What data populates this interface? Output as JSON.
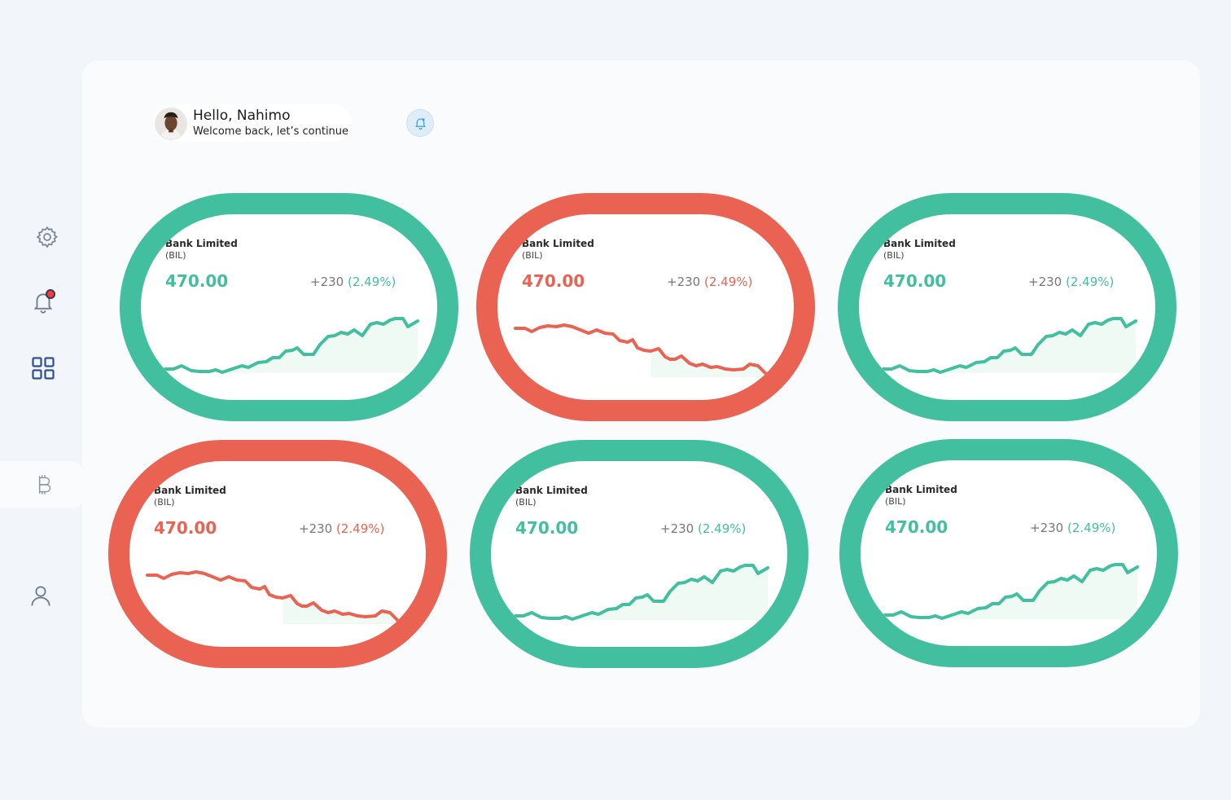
{
  "header": {
    "greeting": "Hello, Nahimo",
    "subtitle": "Welcome back, let’s continue"
  },
  "sidebar": {
    "items": [
      {
        "icon": "gear-icon"
      },
      {
        "icon": "bell-icon",
        "has_badge": true
      },
      {
        "icon": "grid-icon"
      },
      {
        "icon": "bitcoin-icon",
        "active": true
      },
      {
        "icon": "user-icon"
      }
    ]
  },
  "colors": {
    "up": "#41bf9f",
    "down": "#ea6251",
    "page_bg": "#f2f5f9",
    "panel_bg": "#f9fbfd"
  },
  "cards": [
    {
      "name": "Bank Limited",
      "ticker": "(BIL)",
      "price": "470.00",
      "change": "+230",
      "percent": "(2.49%)",
      "trend": "up"
    },
    {
      "name": "Bank Limited",
      "ticker": "(BIL)",
      "price": "470.00",
      "change": "+230",
      "percent": "(2.49%)",
      "trend": "down"
    },
    {
      "name": "Bank Limited",
      "ticker": "(BIL)",
      "price": "470.00",
      "change": "+230",
      "percent": "(2.49%)",
      "trend": "up"
    },
    {
      "name": "Bank Limited",
      "ticker": "(BIL)",
      "price": "470.00",
      "change": "+230",
      "percent": "(2.49%)",
      "trend": "down"
    },
    {
      "name": "Bank Limited",
      "ticker": "(BIL)",
      "price": "470.00",
      "change": "+230",
      "percent": "(2.49%)",
      "trend": "up"
    },
    {
      "name": "Bank Limited",
      "ticker": "(BIL)",
      "price": "470.00",
      "change": "+230",
      "percent": "(2.49%)",
      "trend": "up"
    }
  ]
}
